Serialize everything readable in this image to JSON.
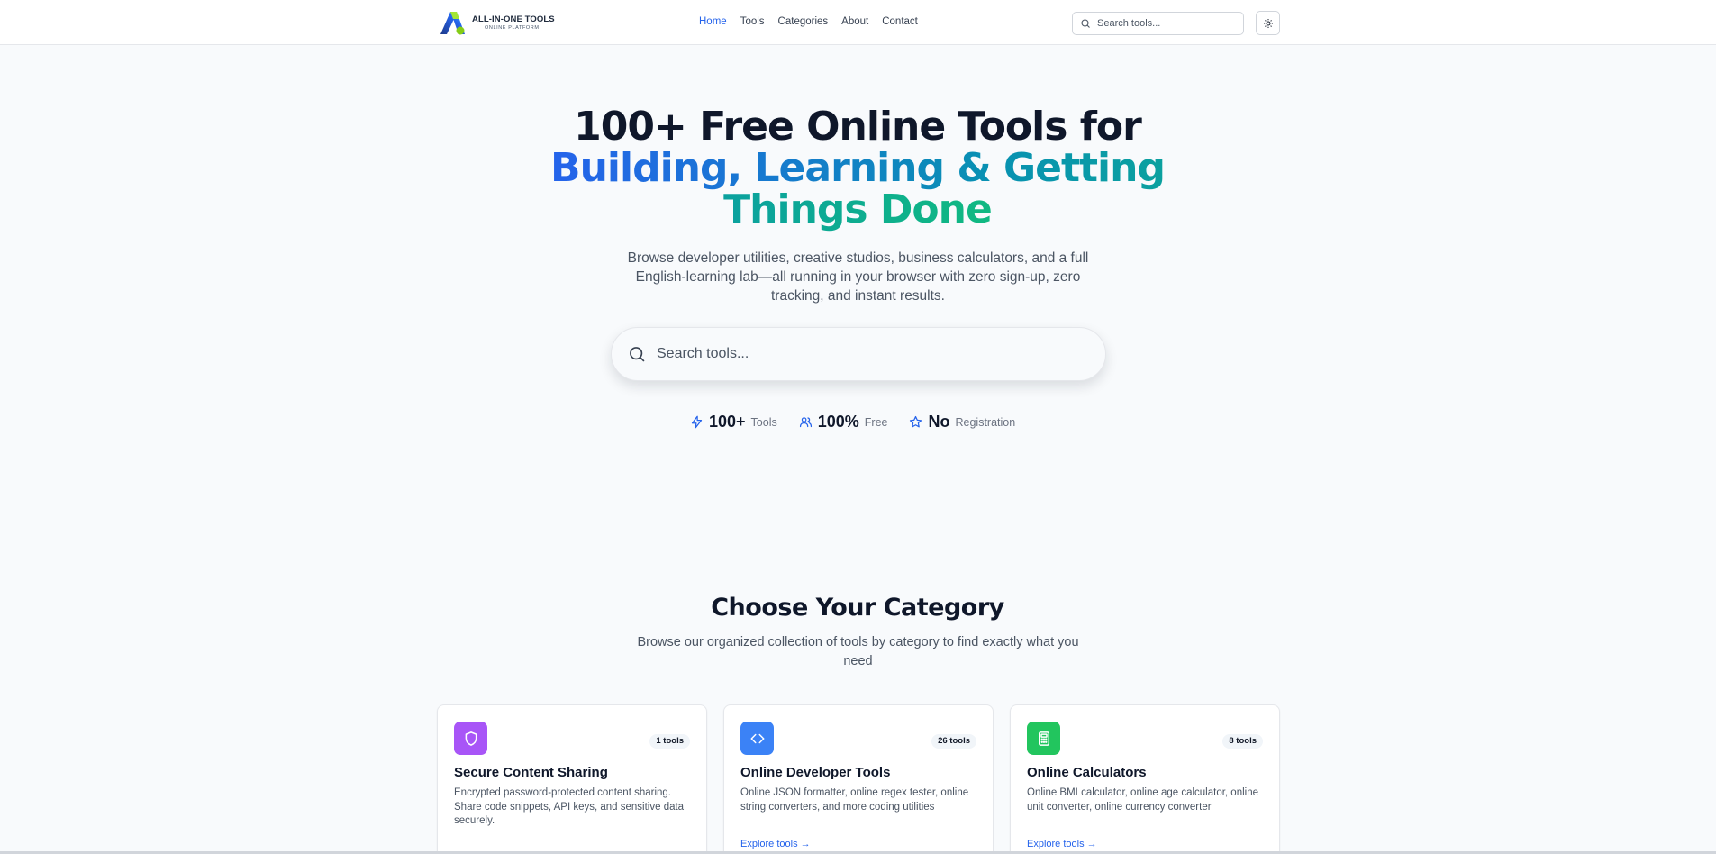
{
  "header": {
    "logo_main": "ALL-IN-ONE TOOLS",
    "logo_sub": "ONLINE PLATFORM",
    "nav": [
      "Home",
      "Tools",
      "Categories",
      "About",
      "Contact"
    ],
    "active_nav": "Home",
    "search_placeholder": "Search tools...",
    "theme_icon": "sun-icon"
  },
  "hero": {
    "title_line1": "100+ Free Online Tools for",
    "title_highlight": "Building, Learning & Getting Things Done",
    "subtitle": "Browse developer utilities, creative studios, business calculators, and a full English-learning lab—all running in your browser with zero sign-up, zero tracking, and instant results.",
    "search_placeholder": "Search tools...",
    "stats": [
      {
        "value": "100+",
        "label": "Tools",
        "icon": "zap-icon"
      },
      {
        "value": "100%",
        "label": "Free",
        "icon": "users-icon"
      },
      {
        "value": "No",
        "label": "Registration",
        "icon": "star-icon"
      }
    ]
  },
  "categories": {
    "title": "Choose Your Category",
    "subtitle": "Browse our organized collection of tools by category to find exactly what you need",
    "cards": [
      {
        "title": "Secure Content Sharing",
        "badge": "1 tools",
        "desc": "Encrypted password-protected content sharing. Share code snippets, API keys, and sensitive data securely.",
        "link": "",
        "icon": "shield-icon",
        "color": "#a855f7"
      },
      {
        "title": "Online Developer Tools",
        "badge": "26 tools",
        "desc": "Online JSON formatter, online regex tester, online string converters, and more coding utilities",
        "link": "Explore tools →",
        "icon": "code-icon",
        "color": "#3b82f6"
      },
      {
        "title": "Online Calculators",
        "badge": "8 tools",
        "desc": "Online BMI calculator, online age calculator, online unit converter, online currency converter",
        "link": "Explore tools →",
        "icon": "calculator-icon",
        "color": "#22c55e"
      }
    ]
  }
}
